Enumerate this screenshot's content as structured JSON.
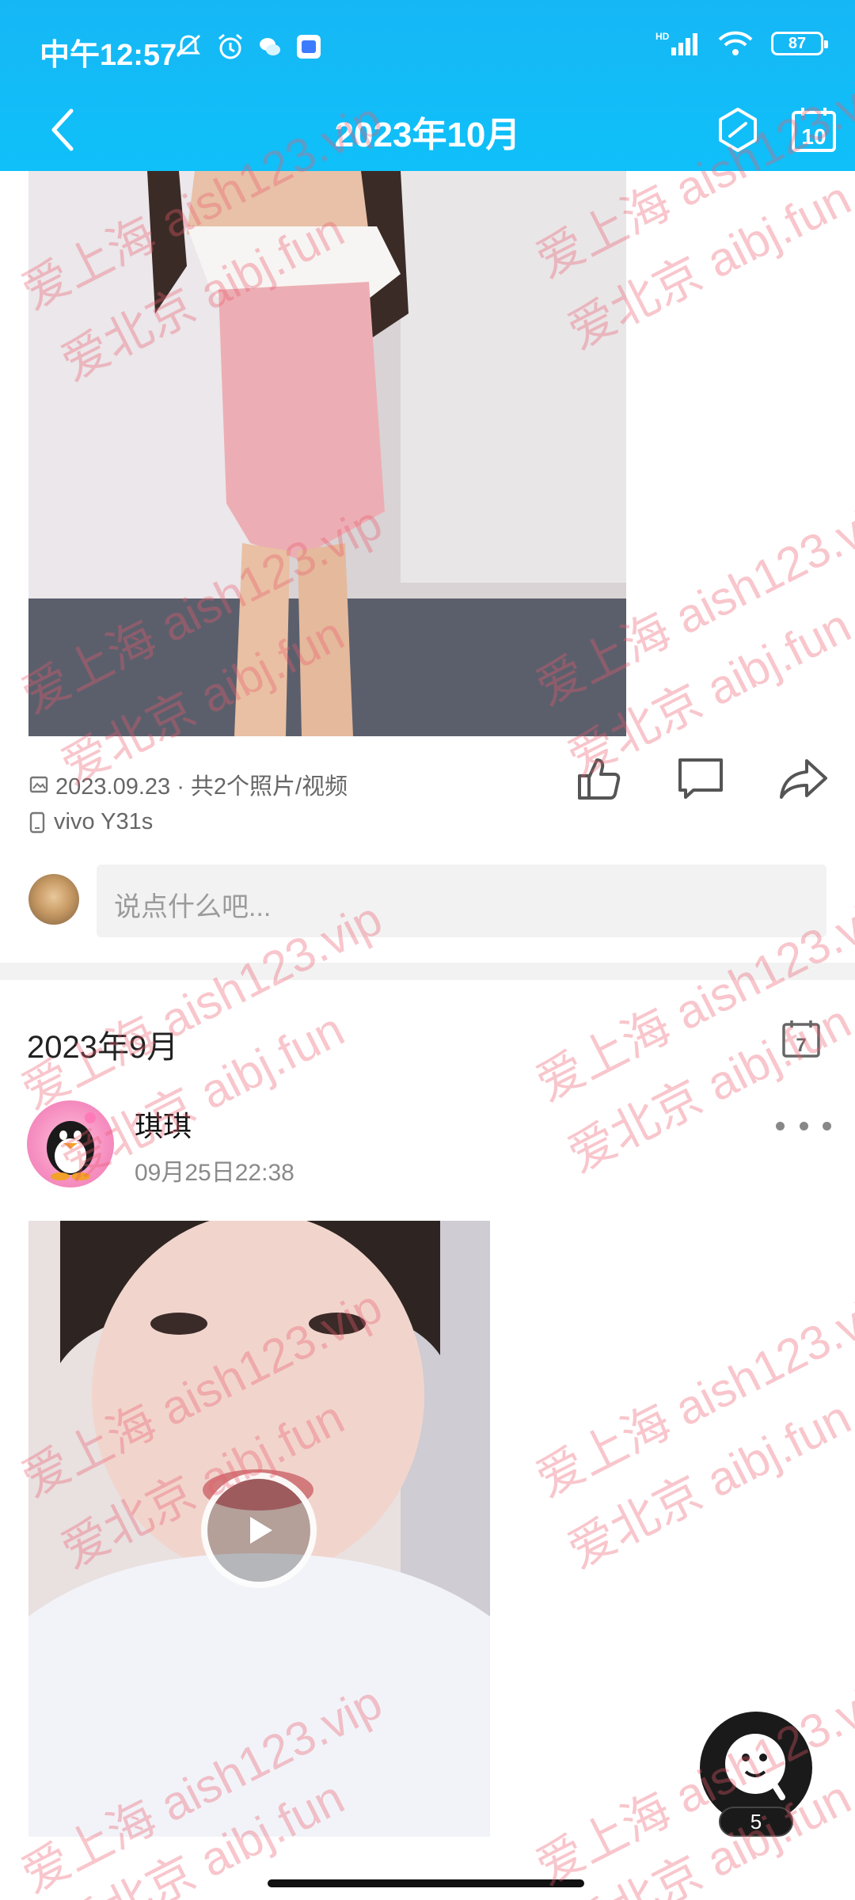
{
  "status_bar": {
    "time": "中午12:57",
    "network": "HD",
    "battery": "87"
  },
  "nav": {
    "title": "2023年10月",
    "calendar_day": "10"
  },
  "post1": {
    "meta": "2023.09.23 · 共2个照片/视频",
    "device": "vivo Y31s",
    "comment_placeholder": "说点什么吧..."
  },
  "section": {
    "month": "2023年9月",
    "calendar_day": "7"
  },
  "post2": {
    "user_name": "琪琪",
    "time": "09月25日22:38"
  },
  "assistant": {
    "badge": "5"
  },
  "watermark": {
    "line_a": "爱上海 aish123.vip",
    "line_b": "爱北京 aibj.fun"
  },
  "colors": {
    "header": "#16b7f5",
    "watermark": "#ec5c6e"
  }
}
